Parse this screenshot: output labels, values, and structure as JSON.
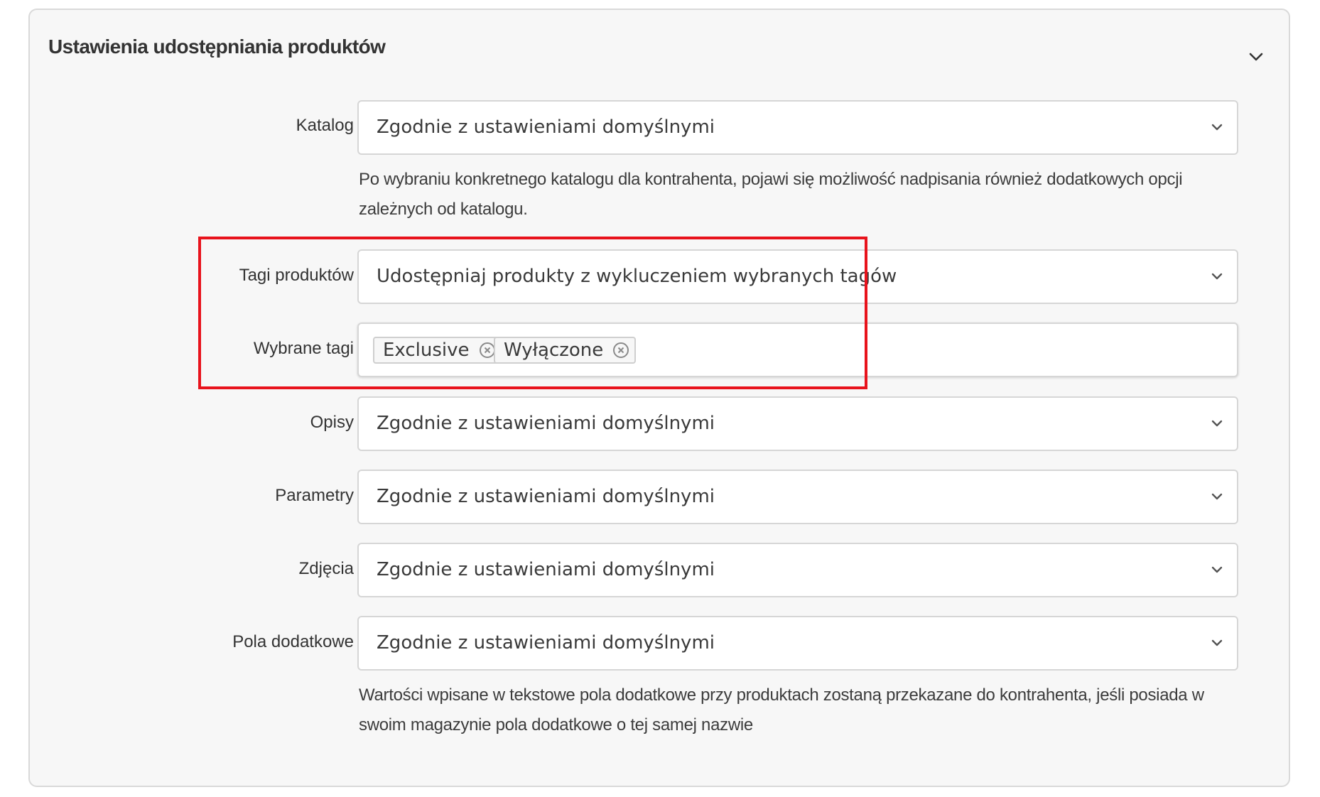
{
  "panel": {
    "title": "Ustawienia udostępniania produktów",
    "toggle_icon": "chevron-down-icon"
  },
  "fields": {
    "katalog": {
      "label": "Katalog",
      "value": "Zgodnie z ustawieniami domyślnymi",
      "help": "Po wybraniu konkretnego katalogu dla kontrahenta, pojawi się możliwość nadpisania również dodatkowych opcji zależnych od katalogu."
    },
    "tagi_produktow": {
      "label": "Tagi produktów",
      "value": "Udostępniaj produkty z wykluczeniem wybranych tagów"
    },
    "wybrane_tagi": {
      "label": "Wybrane tagi",
      "tags": [
        "Exclusive",
        "Wyłączone"
      ],
      "remove_icon": "circle-x-icon"
    },
    "opisy": {
      "label": "Opisy",
      "value": "Zgodnie z ustawieniami domyślnymi"
    },
    "parametry": {
      "label": "Parametry",
      "value": "Zgodnie z ustawieniami domyślnymi"
    },
    "zdjecia": {
      "label": "Zdjęcia",
      "value": "Zgodnie z ustawieniami domyślnymi"
    },
    "pola_dodatkowe": {
      "label": "Pola dodatkowe",
      "value": "Zgodnie z ustawieniami domyślnymi",
      "help": "Wartości wpisane w tekstowe pola dodatkowe przy produktach zostaną przekazane do kontrahenta, jeśli posiada w swoim magazynie pola dodatkowe o tej samej nazwie"
    }
  },
  "colors": {
    "highlight": "#e8131c",
    "panel_bg": "#f7f7f7",
    "border": "#d6d6d6"
  }
}
